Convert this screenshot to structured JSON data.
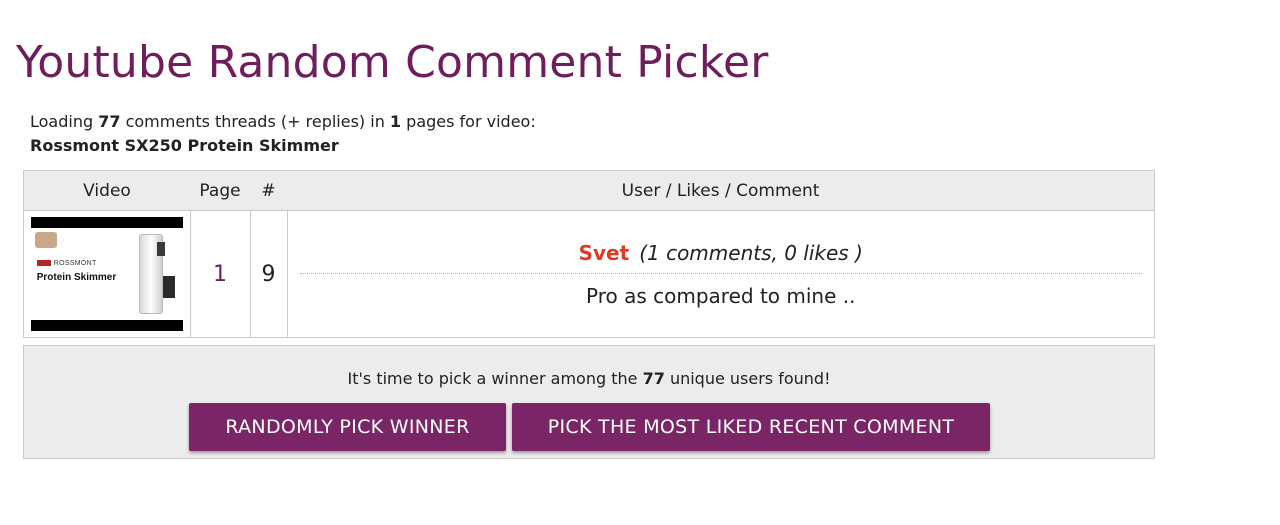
{
  "header": {
    "title": "Youtube Random Comment Picker"
  },
  "loading": {
    "prefix": "Loading",
    "comment_count": "77",
    "middle": "comments threads (+ replies) in",
    "page_count": "1",
    "suffix": "pages for video:",
    "video_title": "Rossmont SX250 Protein Skimmer"
  },
  "table": {
    "headers": {
      "video": "Video",
      "page": "Page",
      "number": "#",
      "comment": "User / Likes / Comment"
    },
    "row": {
      "thumbnail": {
        "brand": "ROSSMONT",
        "product": "Protein Skimmer"
      },
      "page": "1",
      "number": "9",
      "username": "Svet",
      "stats": "(1 comments, 0 likes )",
      "comment": "Pro as compared to mine .."
    }
  },
  "winner": {
    "text_prefix": "It's time to pick a winner among the",
    "unique_users": "77",
    "text_suffix": "unique users found!",
    "random_button": "RANDOMLY PICK WINNER",
    "liked_button": "PICK THE MOST LIKED RECENT COMMENT"
  },
  "colors": {
    "brand_purple": "#6e1f5b",
    "button_purple": "#7a2565",
    "username_red": "#e13a1f",
    "panel_gray": "#ececec"
  }
}
